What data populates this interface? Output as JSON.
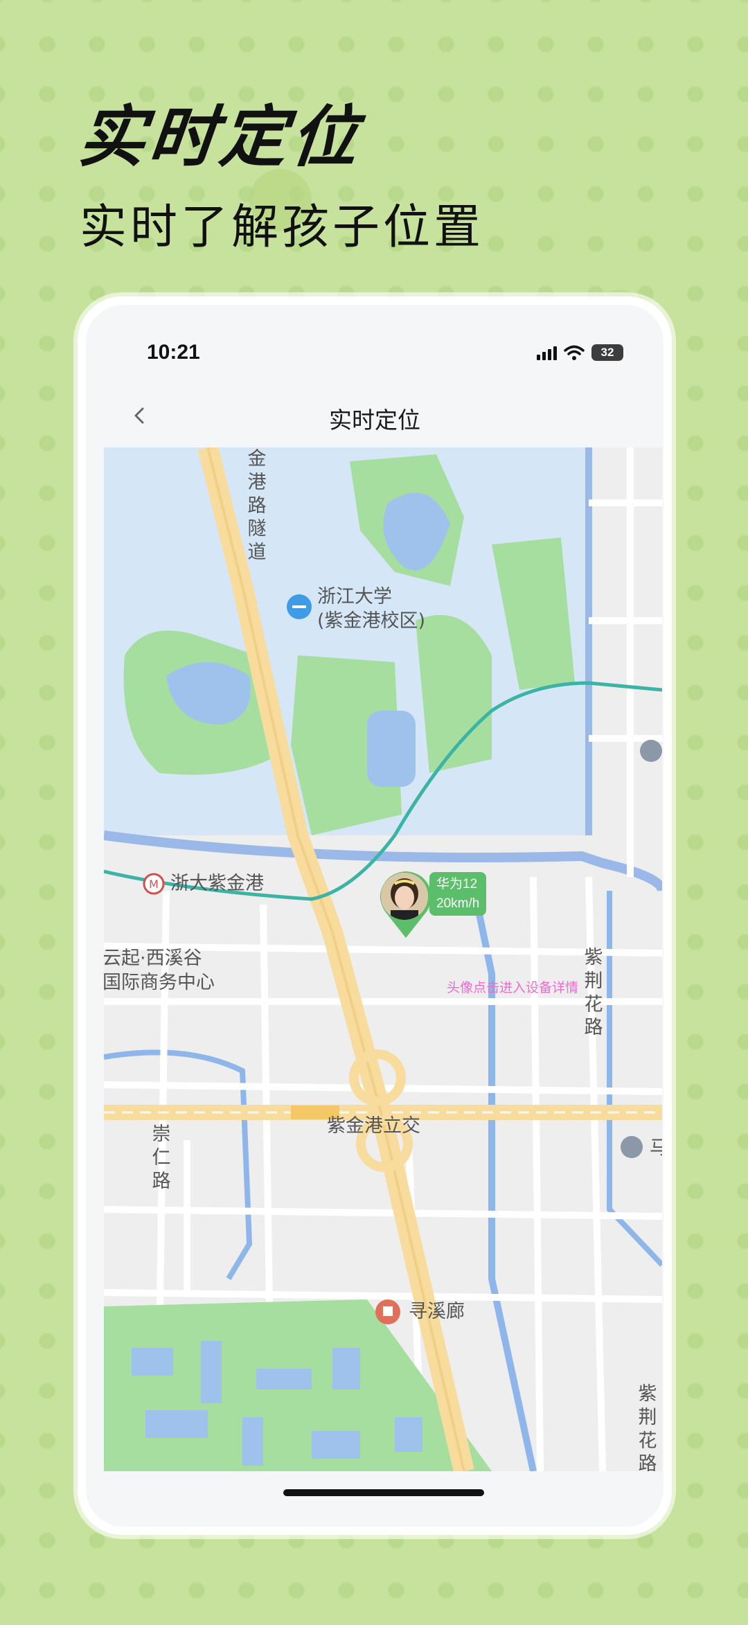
{
  "promo": {
    "headline": "实时定位",
    "subheadline": "实时了解孩子位置"
  },
  "status_bar": {
    "time": "10:21",
    "battery": "32"
  },
  "nav": {
    "title": "实时定位"
  },
  "map": {
    "labels": {
      "university_line1": "浙江大学",
      "university_line2": "(紫金港校区)",
      "metro_station": "浙大紫金港",
      "business_line1": "云起·西溪谷",
      "business_line2": "国际商务中心",
      "interchange": "紫金港立交",
      "attraction": "寻溪廊",
      "road_tunnel": "金港路隧道",
      "road_right": "紫荆花路",
      "road_left": "崇仁路",
      "road_right_lower": "紫荆花路",
      "edge_poi": "马"
    },
    "device": {
      "name": "华为12",
      "speed": "20km/h"
    },
    "hint": "头像点击进入设备详情"
  },
  "colors": {
    "background": "#c6e29c",
    "water": "#d5e7f7",
    "river": "#8fb6ea",
    "green": "#a6dea0",
    "road_major": "#f7dc9e",
    "metro": "#3bb3a5",
    "badge": "#5cbd6a",
    "hint": "#f06ad0"
  },
  "icons": {
    "back": "chevron-left-icon",
    "signal": "signal-icon",
    "wifi": "wifi-icon",
    "battery": "battery-icon",
    "location_marker": "location-pin-icon"
  }
}
